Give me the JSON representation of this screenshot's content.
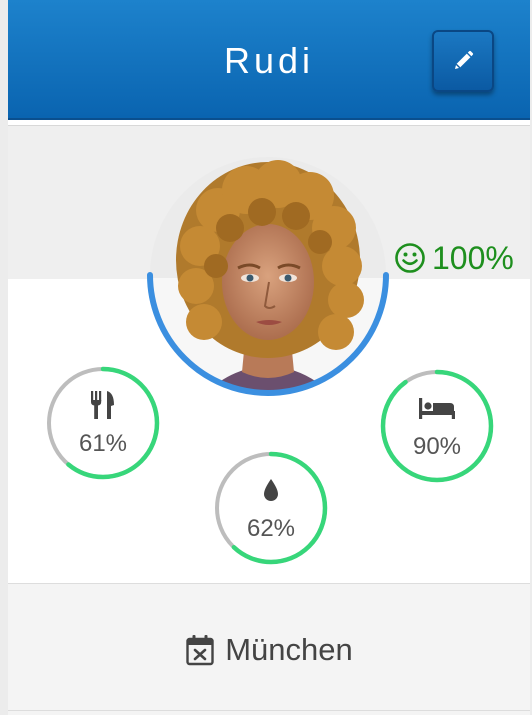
{
  "header": {
    "title": "Rudi",
    "edit_icon": "pencil-icon",
    "brand_color": "#0a64b0"
  },
  "mood": {
    "icon": "smiley-icon",
    "value": "100%",
    "level": 1.0,
    "color": "#1e8f1e"
  },
  "stats": [
    {
      "name": "food",
      "icon": "utensils-icon",
      "label": "61%",
      "level": 0.61
    },
    {
      "name": "water",
      "icon": "droplet-icon",
      "label": "62%",
      "level": 0.62
    },
    {
      "name": "sleep",
      "icon": "bed-icon",
      "label": "90%",
      "level": 0.9
    }
  ],
  "ring_colors": {
    "fill": "#37d67a",
    "track": "#bdbdbd",
    "avatar_ring": "#3b8fe0"
  },
  "footer": {
    "icon": "calendar-x-icon",
    "location": "München"
  }
}
